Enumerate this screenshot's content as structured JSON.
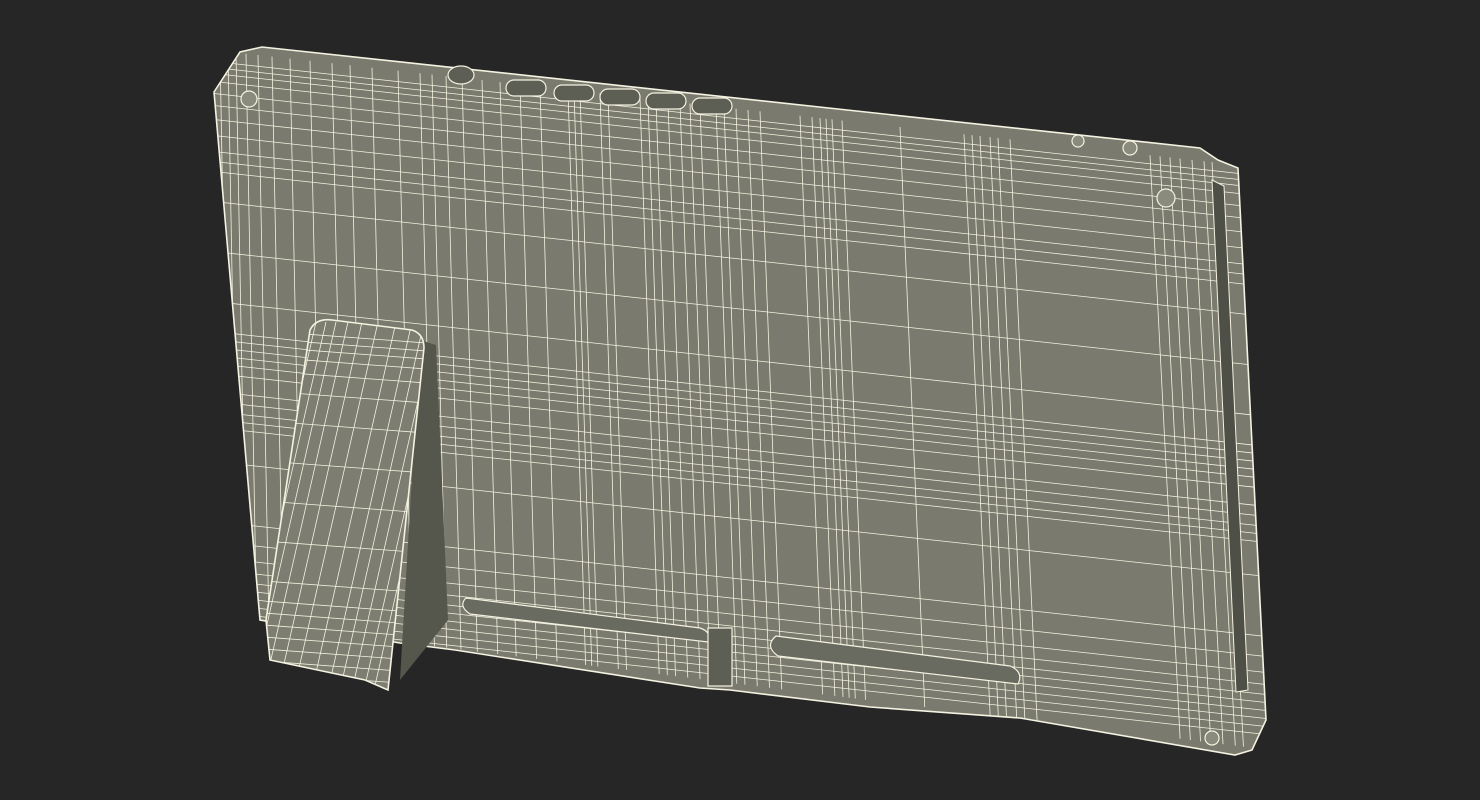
{
  "scene": {
    "background_color": "#262626",
    "body_color": "#7a7b6e",
    "body_shadow_color": "#5d5e54",
    "wire_color": "#f4f2e0",
    "subject": "wireframe-render-handheld-console-back-with-kickstand"
  }
}
